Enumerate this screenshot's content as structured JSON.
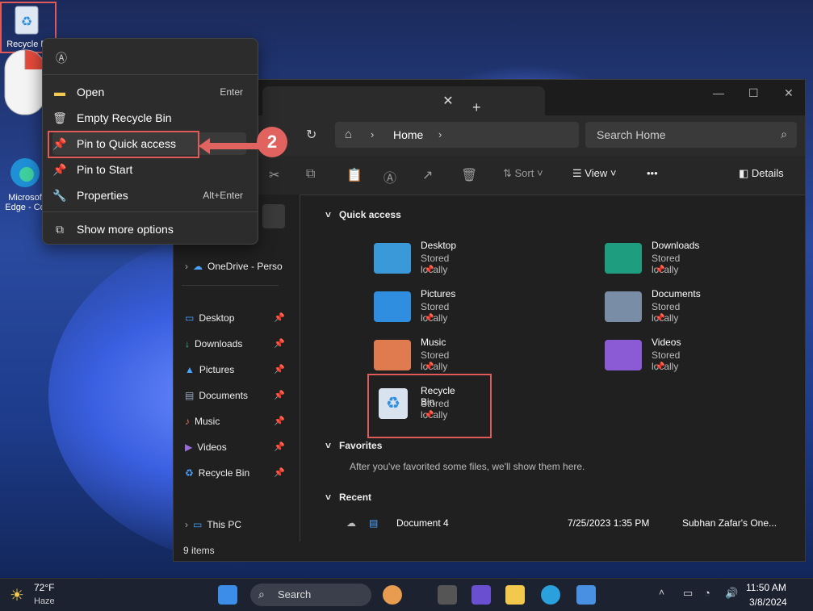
{
  "desktop": {
    "recycle_label": "Recycle B",
    "edge_label_1": "Microsof",
    "edge_label_2": "Edge - Co"
  },
  "context_menu": {
    "items": [
      {
        "label": "Open",
        "accel": "Enter",
        "icon": "folder-icon"
      },
      {
        "label": "Empty Recycle Bin",
        "accel": "",
        "icon": "trash-icon"
      },
      {
        "label": "Pin to Quick access",
        "accel": "",
        "icon": "pin-icon"
      },
      {
        "label": "Pin to Start",
        "accel": "",
        "icon": "pin-icon"
      },
      {
        "label": "Properties",
        "accel": "Alt+Enter",
        "icon": "wrench-icon"
      },
      {
        "label": "Show more options",
        "accel": "",
        "icon": "more-options-icon"
      }
    ],
    "callout_number": "2"
  },
  "explorer": {
    "breadcrumb": "Home",
    "search_placeholder": "Search Home",
    "toolbar": {
      "sort": "Sort",
      "view": "View",
      "more": "•••",
      "details": "Details"
    },
    "sidebar": {
      "onedrive": "OneDrive - Perso",
      "items": [
        "Desktop",
        "Downloads",
        "Pictures",
        "Documents",
        "Music",
        "Videos",
        "Recycle Bin"
      ],
      "this_pc": "This PC"
    },
    "sections": {
      "quick_access": "Quick access",
      "favorites": "Favorites",
      "favorites_empty": "After you've favorited some files, we'll show them here.",
      "recent": "Recent"
    },
    "quick_access": [
      {
        "name": "Desktop",
        "sub": "Stored locally",
        "color": "#3a9ad9"
      },
      {
        "name": "Downloads",
        "sub": "Stored locally",
        "color": "#1e9e7e"
      },
      {
        "name": "Pictures",
        "sub": "Stored locally",
        "color": "#2f8ee0"
      },
      {
        "name": "Documents",
        "sub": "Stored locally",
        "color": "#7a8da6"
      },
      {
        "name": "Music",
        "sub": "Stored locally",
        "color": "#e07b50"
      },
      {
        "name": "Videos",
        "sub": "Stored locally",
        "color": "#8b5bd6"
      },
      {
        "name": "Recycle Bin",
        "sub": "Stored locally",
        "color": "#d9e3ef"
      }
    ],
    "recent": {
      "name": "Document 4",
      "date": "7/25/2023 1:35 PM",
      "location": "Subhan Zafar's One..."
    },
    "status": "9 items"
  },
  "taskbar": {
    "weather_temp": "72°F",
    "weather_desc": "Haze",
    "search": "Search",
    "time": "11:50 AM",
    "date": "3/8/2024"
  }
}
